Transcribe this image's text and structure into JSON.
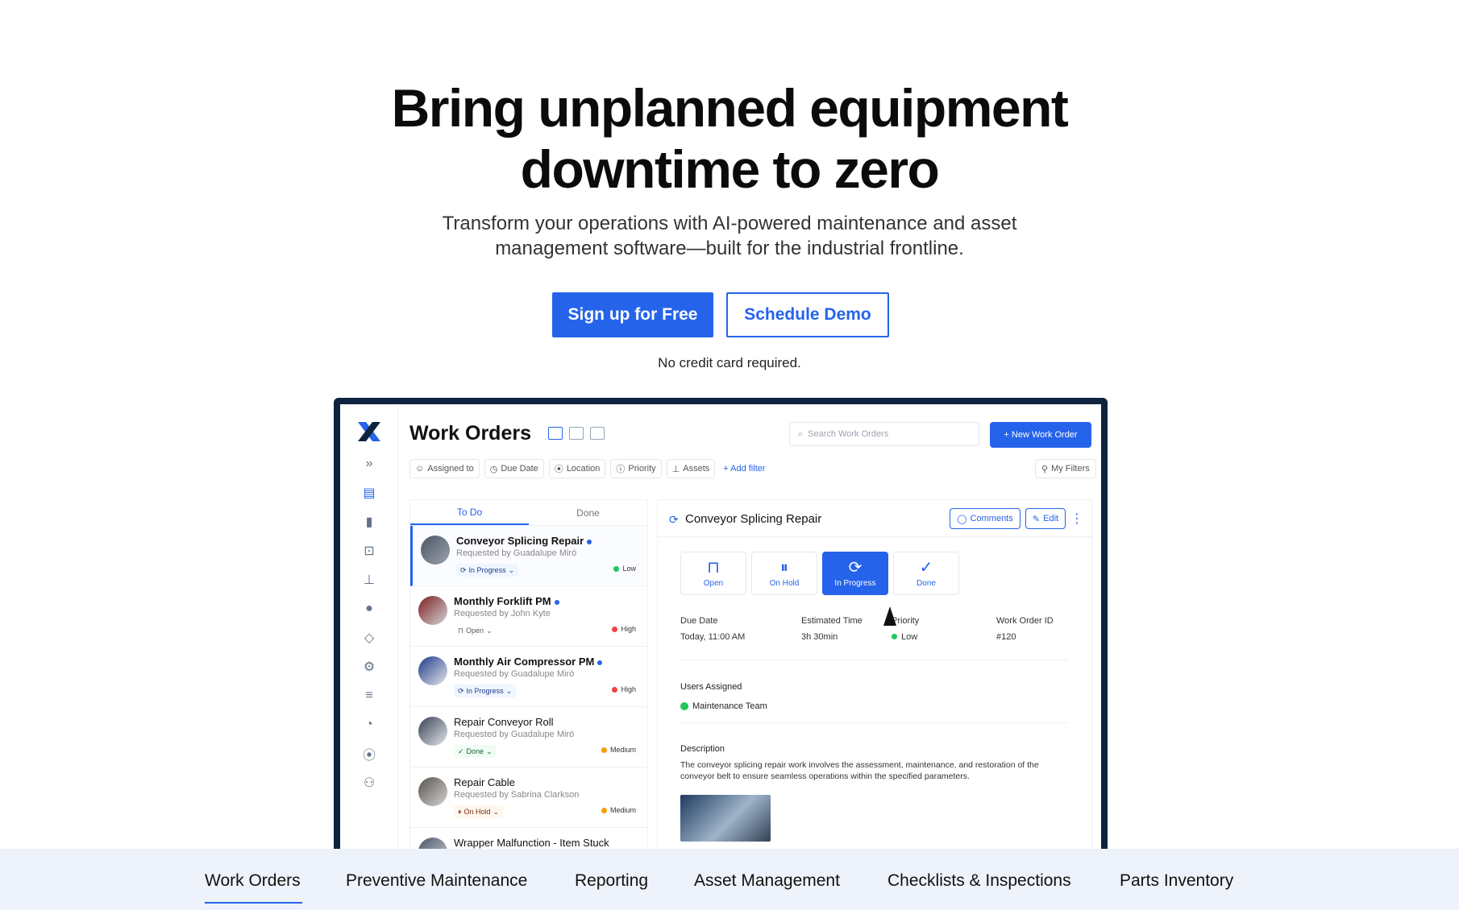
{
  "hero": {
    "title_line1": "Bring unplanned equipment",
    "title_line2": "downtime to zero",
    "subtitle_line1": "Transform your operations with AI-powered maintenance and asset",
    "subtitle_line2": "management software—built for the industrial frontline.",
    "signup_label": "Sign up for Free",
    "demo_label": "Schedule Demo",
    "note": "No credit card required."
  },
  "app": {
    "page_title": "Work Orders",
    "search_placeholder": "Search Work Orders",
    "new_button": "+ New Work Order",
    "filters": [
      "Assigned to",
      "Due Date",
      "Location",
      "Priority",
      "Assets"
    ],
    "add_filter": "+ Add filter",
    "my_filters": "My Filters",
    "tabs": [
      "To Do",
      "Done"
    ],
    "items": [
      {
        "title": "Conveyor Splicing Repair",
        "requester": "Requested by Guadalupe Miró",
        "status": "In Progress",
        "priority": "Low"
      },
      {
        "title": "Monthly Forklift PM",
        "requester": "Requested by John Kyte",
        "status": "Open",
        "priority": "High"
      },
      {
        "title": "Monthly Air Compressor PM",
        "requester": "Requested by Guadalupe Miró",
        "status": "In Progress",
        "priority": "High"
      },
      {
        "title": "Repair Conveyor Roll",
        "requester": "Requested by Guadalupe Miró",
        "status": "Done",
        "priority": "Medium"
      },
      {
        "title": "Repair Cable",
        "requester": "Requested by Sabrina Clarkson",
        "status": "On Hold",
        "priority": "Medium"
      },
      {
        "title": "Wrapper Malfunction - Item Stuck"
      }
    ],
    "detail": {
      "title": "Conveyor Splicing Repair",
      "comments": "Comments",
      "edit": "Edit",
      "status_buttons": [
        "Open",
        "On Hold",
        "In Progress",
        "Done"
      ],
      "due_date_label": "Due Date",
      "due_date": "Today, 11:00 AM",
      "est_label": "Estimated Time",
      "est": "3h 30min",
      "priority_label": "Priority",
      "priority": "Low",
      "wo_id_label": "Work Order ID",
      "wo_id": "#120",
      "users_label": "Users Assigned",
      "users": "Maintenance Team",
      "desc_label": "Description",
      "description": "The conveyor splicing repair work involves the assessment, maintenance, and restoration of the conveyor belt to ensure seamless operations within the specified parameters."
    }
  },
  "bottom_nav": [
    "Work Orders",
    "Preventive Maintenance",
    "Reporting",
    "Asset Management",
    "Checklists & Inspections",
    "Parts Inventory"
  ],
  "colors": {
    "accent": "#2563eb",
    "frame": "#0e2340",
    "low": "#22c55e",
    "high": "#ef4444",
    "medium": "#f59e0b"
  }
}
